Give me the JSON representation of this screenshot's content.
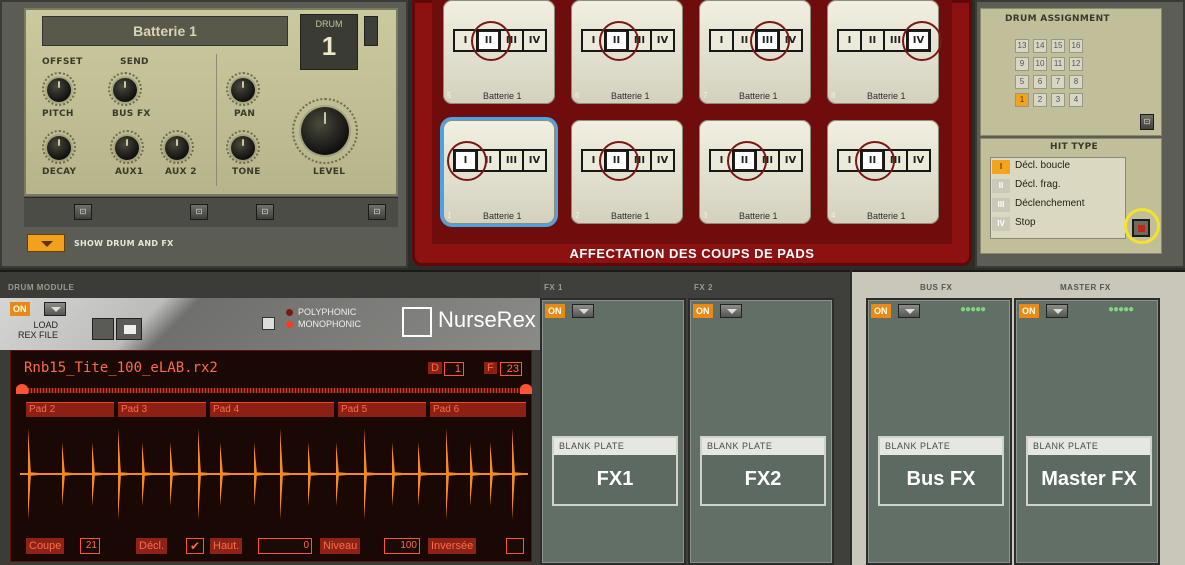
{
  "drum_panel": {
    "name": "Batterie 1",
    "drum_label": "DRUM",
    "drum_number": "1",
    "offset": "OFFSET",
    "send": "SEND",
    "pitch": "PITCH",
    "bus_fx": "BUS FX",
    "pan": "PAN",
    "decay": "DECAY",
    "aux1": "AUX1",
    "aux2": "AUX 2",
    "tone": "TONE",
    "level": "LEVEL",
    "show_drum_fx": "SHOW DRUM AND FX"
  },
  "pads": {
    "top": [
      {
        "num": "5",
        "name": "Batterie 1",
        "active": "II"
      },
      {
        "num": "6",
        "name": "Batterie 1",
        "active": "II"
      },
      {
        "num": "7",
        "name": "Batterie 1",
        "active": "III"
      },
      {
        "num": "8",
        "name": "Batterie 1",
        "active": "IV"
      }
    ],
    "bottom": [
      {
        "num": "1",
        "name": "Batterie 1",
        "active": "I"
      },
      {
        "num": "2",
        "name": "Batterie 1",
        "active": "II"
      },
      {
        "num": "3",
        "name": "Batterie 1",
        "active": "II"
      },
      {
        "num": "4",
        "name": "Batterie 1",
        "active": "II"
      }
    ],
    "segments": [
      "I",
      "II",
      "III",
      "IV"
    ],
    "caption": "AFFECTATION DES COUPS DE PADS"
  },
  "assignment": {
    "title": "DRUM ASSIGNMENT",
    "rows": [
      [
        "13",
        "14",
        "15",
        "16"
      ],
      [
        "9",
        "10",
        "11",
        "12"
      ],
      [
        "5",
        "6",
        "7",
        "8"
      ],
      [
        "1",
        "2",
        "3",
        "4"
      ]
    ],
    "selected": "1"
  },
  "hit_type": {
    "title": "HIT TYPE",
    "items": [
      {
        "code": "I",
        "label": "Décl. boucle"
      },
      {
        "code": "II",
        "label": "Décl. frag."
      },
      {
        "code": "III",
        "label": "Déclenchement"
      },
      {
        "code": "IV",
        "label": "Stop"
      }
    ],
    "selected": "I"
  },
  "drum_module": {
    "header": "DRUM MODULE",
    "on": "ON",
    "load_line1": "LOAD",
    "load_line2": "REX FILE",
    "poly": "POLYPHONIC",
    "mono": "MONOPHONIC",
    "brand": "NurseRex",
    "file": "Rnb15_Tite_100_eLAB.rx2",
    "d_label": "D",
    "d_val": "1",
    "f_label": "F",
    "f_val": "23",
    "pads": [
      "Pad 2",
      "Pad 3",
      "Pad 4",
      "Pad 5",
      "Pad 6"
    ],
    "params": {
      "coupe_label": "Coupe",
      "coupe_val": "21",
      "decl_label": "Décl.",
      "haut_label": "Haut.",
      "haut_val": "0",
      "niveau_label": "Niveau",
      "niveau_val": "100",
      "inversee_label": "Inversée"
    }
  },
  "fx": {
    "fx1_header": "FX 1",
    "fx2_header": "FX 2",
    "bus_header": "BUS FX",
    "master_header": "MASTER FX",
    "on": "ON",
    "plate_label": "BLANK PLATE",
    "fx1": "FX1",
    "fx2": "FX2",
    "bus": "Bus FX",
    "master": "Master FX"
  }
}
